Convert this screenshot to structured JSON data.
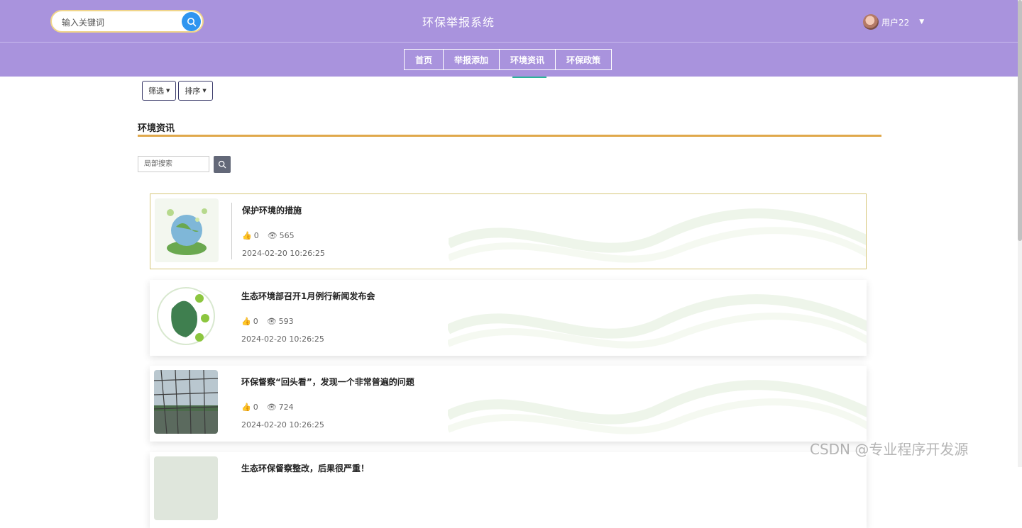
{
  "header": {
    "search_placeholder": "输入关键词",
    "site_title": "环保举报系统",
    "username": "用户22"
  },
  "nav": {
    "items": [
      {
        "label": "首页"
      },
      {
        "label": "举报添加"
      },
      {
        "label": "环境资讯"
      },
      {
        "label": "环保政策"
      }
    ],
    "active_index": 2
  },
  "filters": {
    "filter_label": "筛选",
    "sort_label": "排序"
  },
  "section": {
    "title": "环境资讯",
    "local_search_placeholder": "局部搜索"
  },
  "articles": [
    {
      "title": "保护环境的措施",
      "likes": "0",
      "views": "565",
      "date": "2024-02-20 10:26:25"
    },
    {
      "title": "生态环境部召开1月例行新闻发布会",
      "likes": "0",
      "views": "593",
      "date": "2024-02-20 10:26:25"
    },
    {
      "title": "环保督察“回头看”，发现一个非常普遍的问题",
      "likes": "0",
      "views": "724",
      "date": "2024-02-20 10:26:25"
    },
    {
      "title": "生态环保督察整改，后果很严重！",
      "likes": "",
      "views": "",
      "date": ""
    }
  ],
  "watermark": "CSDN @专业程序开发源",
  "colors": {
    "header_bg": "#a993dd",
    "accent_line": "#e0a84b",
    "search_button": "#2f95f0",
    "active_tab_underline": "#2bb39a"
  }
}
